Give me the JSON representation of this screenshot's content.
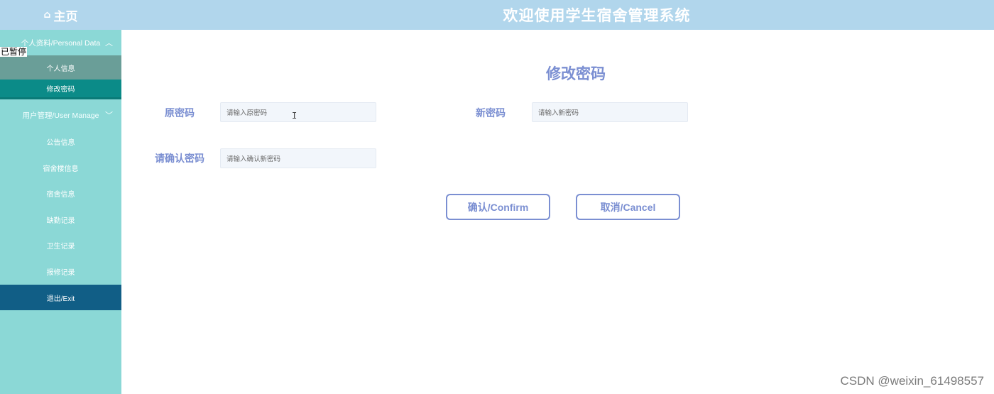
{
  "header": {
    "home_label": "主页",
    "home_icon": "home-icon",
    "title": "欢迎使用学生宿舍管理系统"
  },
  "sidebar": {
    "groups": [
      {
        "label": "个人资料/Personal Data",
        "expanded": true,
        "items": [
          {
            "label": "个人信息",
            "active": false
          },
          {
            "label": "修改密码",
            "active": true
          }
        ]
      },
      {
        "label": "用户管理/User Manage",
        "expanded": false,
        "items": [
          {
            "label": "公告信息"
          },
          {
            "label": "宿舍楼信息"
          },
          {
            "label": "宿舍信息"
          },
          {
            "label": "缺勤记录"
          },
          {
            "label": "卫生记录"
          },
          {
            "label": "报修记录"
          }
        ]
      }
    ],
    "exit_label": "退出/Exit"
  },
  "overlay": {
    "paused_label": "已暂停"
  },
  "form": {
    "title": "修改密码",
    "old_password": {
      "label": "原密码",
      "placeholder": "请输入原密码",
      "value": ""
    },
    "new_password": {
      "label": "新密码",
      "placeholder": "请输入新密码",
      "value": ""
    },
    "confirm_password": {
      "label": "请确认密码",
      "placeholder": "请输入确认新密码",
      "value": ""
    },
    "confirm_label": "确认/Confirm",
    "cancel_label": "取消/Cancel"
  },
  "watermark": "CSDN @weixin_61498557",
  "colors": {
    "topbar": "#b1d6ec",
    "sidebar": "#8bd8d6",
    "active_item": "#0b8b88",
    "exit_item": "#115e86",
    "accent": "#7b8fd2"
  }
}
